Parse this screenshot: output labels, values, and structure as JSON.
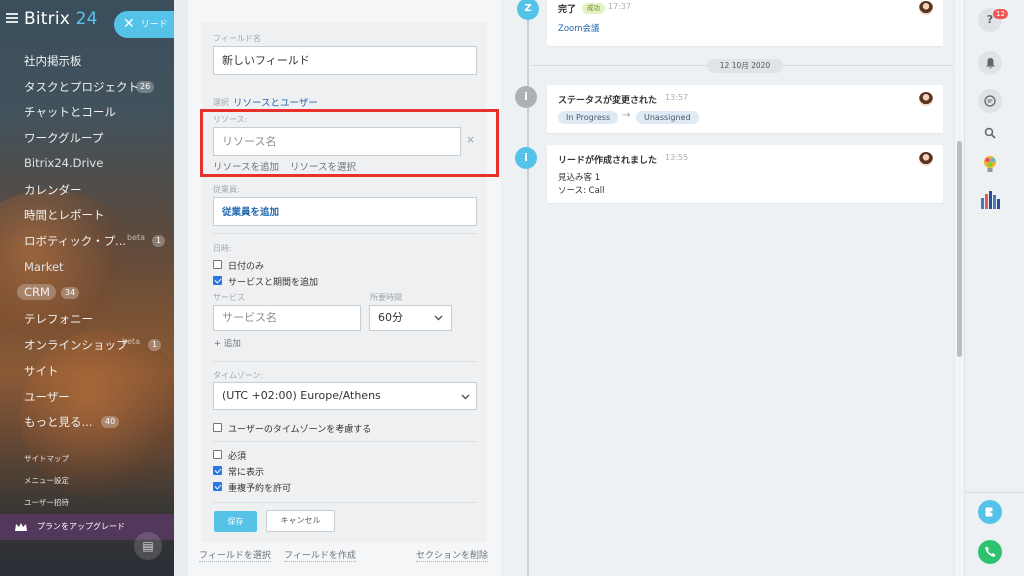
{
  "sidebar": {
    "brand_main": "Bitrix",
    "brand_num": "24",
    "lead_button": "リード",
    "items": [
      {
        "label": "社内掲示板"
      },
      {
        "label": "タスクとプロジェクト",
        "counter": "26"
      },
      {
        "label": "チャットとコール"
      },
      {
        "label": "ワークグループ"
      },
      {
        "label": "Bitrix24.Drive"
      },
      {
        "label": "カレンダー"
      },
      {
        "label": "時間とレポート"
      },
      {
        "label": "ロボティック・プ...",
        "beta": "beta",
        "counter": "1"
      },
      {
        "label": "Market"
      },
      {
        "label": "CRM",
        "counter": "34"
      },
      {
        "label": "テレフォニー"
      },
      {
        "label": "オンラインショップ",
        "beta": "beta",
        "counter": "1"
      },
      {
        "label": "サイト"
      },
      {
        "label": "ユーザー"
      },
      {
        "label": "もっと見る...",
        "counter": "40"
      }
    ],
    "small_links": [
      "サイトマップ",
      "メニュー設定",
      "ユーザー招待"
    ],
    "upgrade": "プランをアップグレード"
  },
  "form": {
    "field_name_label": "フィールド名",
    "field_name_value": "新しいフィールド",
    "select_prefix": "選択",
    "select_link": "リソースとユーザー",
    "resource_label": "リソース:",
    "resource_placeholder": "リソース名",
    "resource_clear": "×",
    "add_resource": "リソースを追加",
    "select_resource": "リソースを選択",
    "employee_label": "従業員:",
    "add_employee": "従業員を追加",
    "datetime_label": "日時:",
    "date_only": "日付のみ",
    "add_service": "サービスと期間を追加",
    "service_label": "サービス",
    "duration_label": "所要時間",
    "service_placeholder": "サービス名",
    "duration_value": "60分",
    "add_link": "+ 追加",
    "timezone_label": "タイムゾーン:",
    "timezone_value": "(UTC +02:00) Europe/Athens",
    "user_timezone": "ユーザーのタイムゾーンを考慮する",
    "required": "必須",
    "always_show": "常に表示",
    "allow_double": "重複予約を許可",
    "save": "保存",
    "cancel": "キャンセル",
    "footer_select_field": "フィールドを選択",
    "footer_create_field": "フィールドを作成",
    "footer_delete_section": "セクションを削除"
  },
  "timeline": {
    "card1": {
      "title": "完了",
      "badge": "成功",
      "time": "17:37",
      "link": "Zoom会議"
    },
    "date_separator": "12 10月 2020",
    "card2": {
      "title": "ステータスが変更された",
      "time": "13:57",
      "from": "In Progress",
      "arrow": "→",
      "to": "Unassigned"
    },
    "card3": {
      "title": "リードが作成されました",
      "time": "13:55",
      "line1": "見込み客 1",
      "line2": "ソース: Call"
    }
  },
  "rightbar": {
    "help_badge": "12"
  },
  "colors": {
    "accent": "#55c3e8",
    "link": "#2067b0",
    "highlight": "#e6322b",
    "success": "#9dcf00",
    "call": "#2fc26e"
  }
}
